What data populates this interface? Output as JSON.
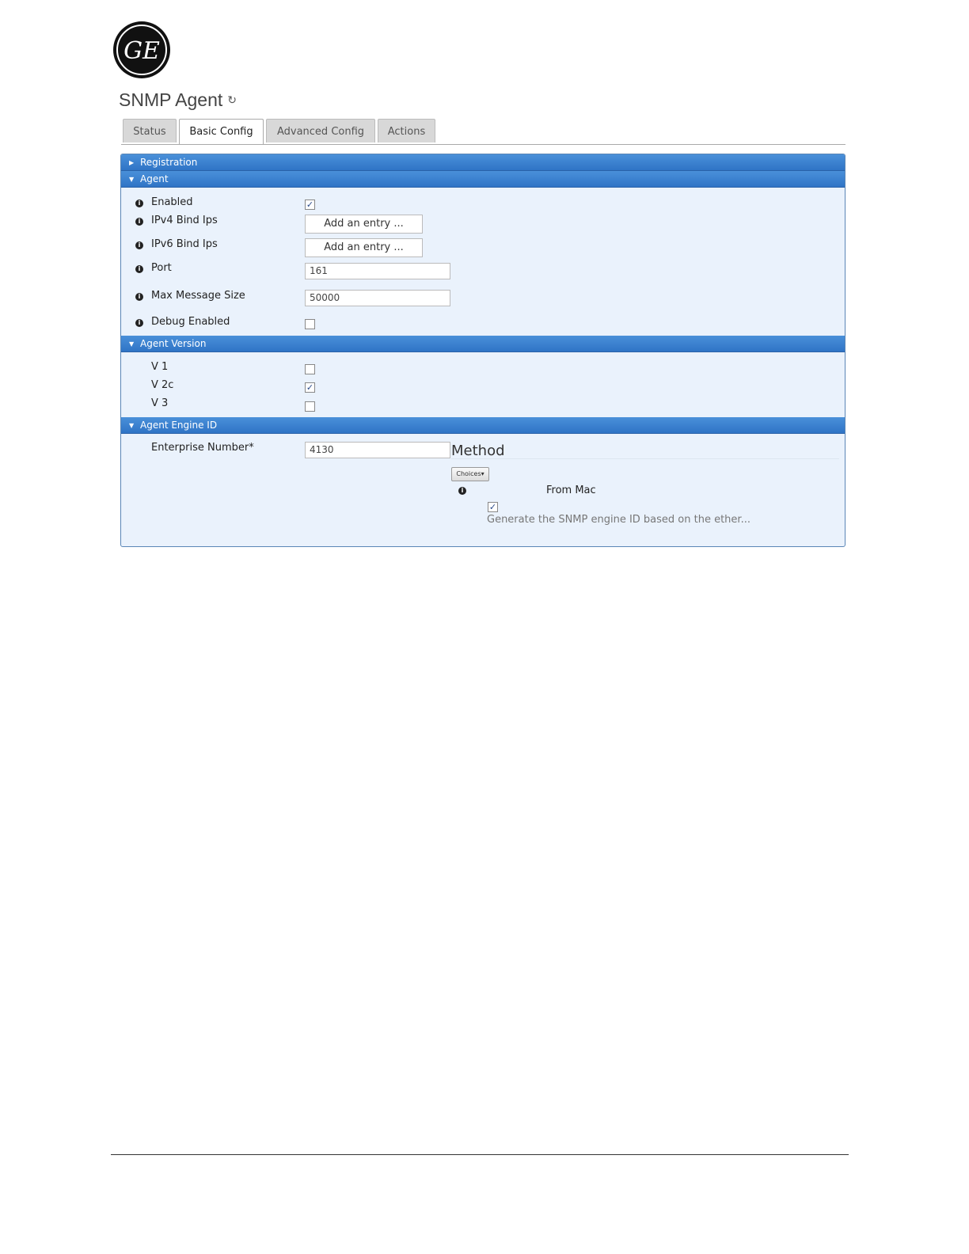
{
  "page": {
    "title": "SNMP Agent",
    "refresh_icon": "refresh-icon"
  },
  "logo": {
    "text": "GE",
    "name": "ge-logo"
  },
  "tabs": [
    {
      "label": "Status",
      "active": false
    },
    {
      "label": "Basic Config",
      "active": true
    },
    {
      "label": "Advanced Config",
      "active": false
    },
    {
      "label": "Actions",
      "active": false
    }
  ],
  "sections": {
    "registration": {
      "title": "Registration",
      "expanded": false
    },
    "agent": {
      "title": "Agent",
      "expanded": true
    },
    "agent_version": {
      "title": "Agent Version",
      "expanded": true
    },
    "agent_engine_id": {
      "title": "Agent Engine ID",
      "expanded": true
    }
  },
  "agent": {
    "enabled": {
      "label": "Enabled",
      "checked": true
    },
    "ipv4_bind_ips": {
      "label": "IPv4 Bind Ips",
      "button": "Add an entry ..."
    },
    "ipv6_bind_ips": {
      "label": "IPv6 Bind Ips",
      "button": "Add an entry ..."
    },
    "port": {
      "label": "Port",
      "value": "161"
    },
    "max_message_size": {
      "label": "Max Message Size",
      "value": "50000"
    },
    "debug_enabled": {
      "label": "Debug Enabled",
      "checked": false
    }
  },
  "agent_version": {
    "v1": {
      "label": "V 1",
      "checked": false
    },
    "v2c": {
      "label": "V 2c",
      "checked": true
    },
    "v3": {
      "label": "V 3",
      "checked": false
    }
  },
  "agent_engine_id": {
    "enterprise_number": {
      "label": "Enterprise Number*",
      "value": "4130"
    },
    "method": {
      "title": "Method",
      "choices_label": "Choices",
      "from_mac": {
        "label": "From Mac",
        "checked": true
      },
      "description": "Generate the SNMP engine ID based on the ether..."
    }
  },
  "colors": {
    "header_blue": "#2f74c6",
    "panel_bg": "#eaf2fc",
    "panel_border": "#5a86b6"
  }
}
